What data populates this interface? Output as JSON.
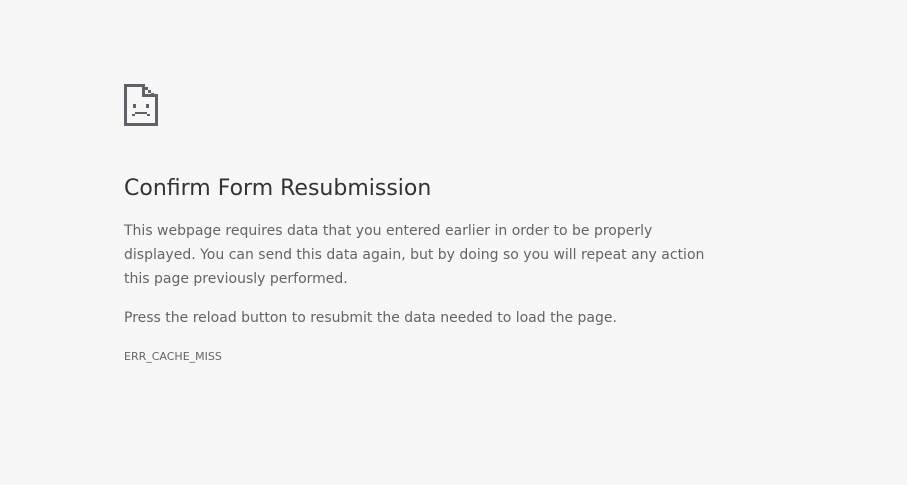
{
  "icon": "sad-document-icon",
  "error": {
    "title": "Confirm Form Resubmission",
    "paragraph_1": "This webpage requires data that you entered earlier in order to be properly displayed. You can send this data again, but by doing so you will repeat any action this page previously performed.",
    "paragraph_2": "Press the reload button to resubmit the data needed to load the page.",
    "code": "ERR_CACHE_MISS"
  },
  "colors": {
    "background": "#f7f7f7",
    "title": "#333333",
    "text": "#646464"
  }
}
